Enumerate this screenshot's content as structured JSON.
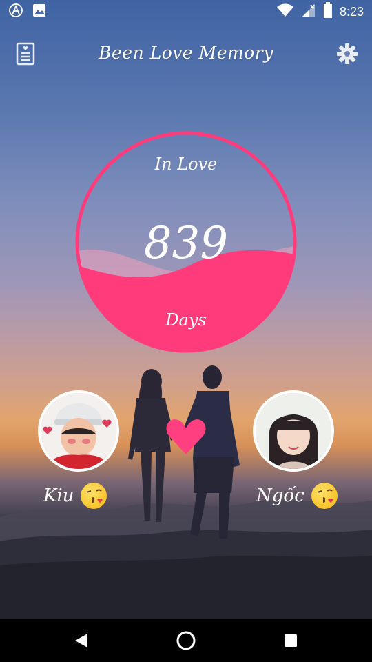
{
  "status_bar": {
    "time": "8:23",
    "icons": [
      "app-notification-icon",
      "image-notification-icon",
      "wifi-icon",
      "signal-icon",
      "battery-icon"
    ]
  },
  "app_bar": {
    "title": "Been Love Memory",
    "left_icon": "notes-icon",
    "right_icon": "gear-icon"
  },
  "counter": {
    "top_label": "In Love",
    "value": "839",
    "bottom_label": "Days",
    "fill_color": "#ff3b7b",
    "wave_level": 0.4
  },
  "couple": {
    "left_name": "Kiu",
    "right_name": "Ngốc",
    "emoji": "kissing-face-emoji",
    "heart_color": "#ff3f7f"
  },
  "nav_bar": {
    "icons": [
      "back-icon",
      "home-icon",
      "recents-icon"
    ]
  },
  "colors": {
    "accent": "#ff3b7b",
    "sky_top": "#3f63a3",
    "sunset": "#e2a46c"
  }
}
